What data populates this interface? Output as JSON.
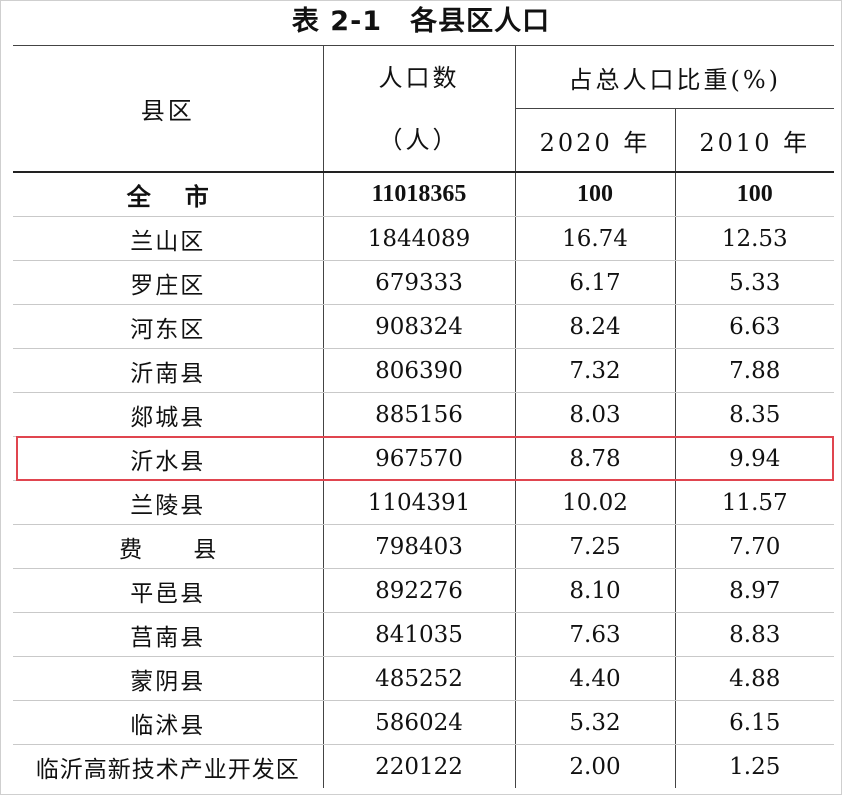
{
  "title": {
    "number": "表 2-1",
    "text": "各县区人口"
  },
  "header": {
    "county": "县区",
    "population_label": "人口数",
    "population_unit": "（人）",
    "share_label": "占总人口比重(%)",
    "year_2020": "2020 年",
    "year_2010": "2010 年"
  },
  "highlight": {
    "row": "沂水县",
    "color": "#e0454f"
  },
  "rows": [
    {
      "name": "全  市",
      "population": "11018365",
      "share_2020": "100",
      "share_2010": "100"
    },
    {
      "name": "兰山区",
      "population": "1844089",
      "share_2020": "16.74",
      "share_2010": "12.53"
    },
    {
      "name": "罗庄区",
      "population": "679333",
      "share_2020": "6.17",
      "share_2010": "5.33"
    },
    {
      "name": "河东区",
      "population": "908324",
      "share_2020": "8.24",
      "share_2010": "6.63"
    },
    {
      "name": "沂南县",
      "population": "806390",
      "share_2020": "7.32",
      "share_2010": "7.88"
    },
    {
      "name": "郯城县",
      "population": "885156",
      "share_2020": "8.03",
      "share_2010": "8.35"
    },
    {
      "name": "沂水县",
      "population": "967570",
      "share_2020": "8.78",
      "share_2010": "9.94"
    },
    {
      "name": "兰陵县",
      "population": "1104391",
      "share_2020": "10.02",
      "share_2010": "11.57"
    },
    {
      "name": "费  县",
      "population": "798403",
      "share_2020": "7.25",
      "share_2010": "7.70"
    },
    {
      "name": "平邑县",
      "population": "892276",
      "share_2020": "8.10",
      "share_2010": "8.97"
    },
    {
      "name": "莒南县",
      "population": "841035",
      "share_2020": "7.63",
      "share_2010": "8.83"
    },
    {
      "name": "蒙阴县",
      "population": "485252",
      "share_2020": "4.40",
      "share_2010": "4.88"
    },
    {
      "name": "临沭县",
      "population": "586024",
      "share_2020": "5.32",
      "share_2010": "6.15"
    },
    {
      "name": "临沂高新技术产业开发区",
      "population": "220122",
      "share_2020": "2.00",
      "share_2010": "1.25"
    }
  ]
}
